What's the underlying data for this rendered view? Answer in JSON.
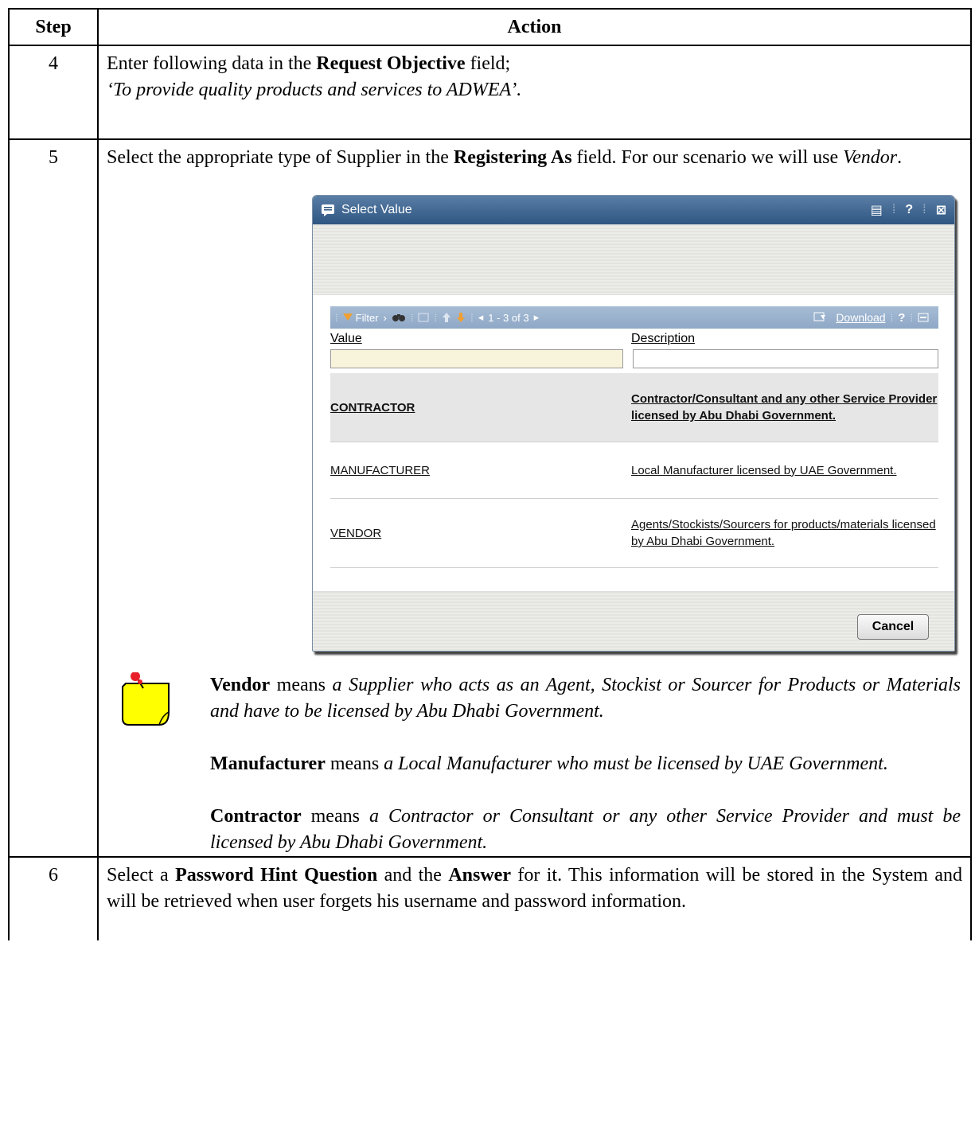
{
  "table": {
    "header_step": "Step",
    "header_action": "Action"
  },
  "step4": {
    "number": "4",
    "intro": "Enter following data in the ",
    "field": "Request Objective",
    "intro_end": " field;",
    "value": "‘To provide quality products and services to ADWEA’."
  },
  "step5": {
    "number": "5",
    "text_a": "Select the appropriate type of Supplier in the ",
    "field": "Registering As",
    "text_b": " field. For our scenario we will use ",
    "choice": "Vendor",
    "text_end": "."
  },
  "dialog": {
    "title": "Select Value",
    "controls": [
      "▤",
      "?",
      "⊠"
    ],
    "toolbar": {
      "filter_label": "Filter",
      "range_label": "1 - 3 of 3",
      "download_label": "Download",
      "help_label": "?"
    },
    "columns": {
      "value": "Value",
      "description": "Description"
    },
    "rows": [
      {
        "value": "CONTRACTOR",
        "description": "Contractor/Consultant and any other Service Provider licensed by Abu Dhabi Government."
      },
      {
        "value": "MANUFACTURER",
        "description": "Local Manufacturer licensed by UAE Government."
      },
      {
        "value": "VENDOR",
        "description": "Agents/Stockists/Sourcers for products/materials licensed by Abu Dhabi Government."
      }
    ],
    "cancel_label": "Cancel"
  },
  "notes": {
    "vendor_term": "Vendor",
    "vendor_means": " means ",
    "vendor_def": "a Supplier who acts as an Agent, Stockist or Sourcer for Products or Materials and have to be licensed by Abu Dhabi Government.",
    "manufacturer_term": "Manufacturer",
    "manufacturer_means": " means ",
    "manufacturer_def": "a Local Manufacturer who must be licensed by UAE Government.",
    "contractor_term": "Contractor",
    "contractor_means": " means ",
    "contractor_def": "a Contractor or Consultant or any other Service Provider and must be licensed by Abu Dhabi Government."
  },
  "step6": {
    "number": "6",
    "text_a": "Select a ",
    "question": "Password Hint Question",
    "text_b": " and the ",
    "answer": "Answer",
    "text_c": " for it. This information will be stored in the System and will be retrieved when user forgets his username and password information."
  },
  "colors": {
    "title_bar": "#2e5682",
    "toolbar": "#8fa8c6",
    "note_yellow": "#ffff00",
    "pin_red": "#e8202a"
  }
}
